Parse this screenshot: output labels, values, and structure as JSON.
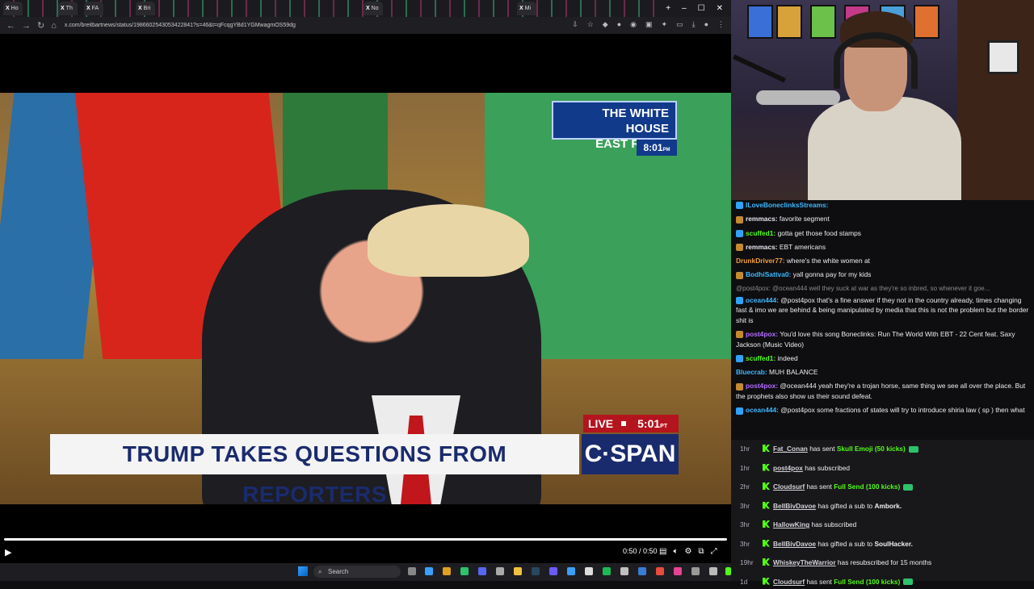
{
  "browser": {
    "tabs": [
      "Ho",
      "Th",
      "FA",
      "Bri",
      "No",
      "Mi"
    ],
    "url": "x.com/breitbartnews/status/1986602543053422841?s=46&t=qFcqgYBd1YGMwagmOS59dg",
    "window_controls": {
      "minimize": "–",
      "maximize": "☐",
      "close": "✕"
    }
  },
  "video": {
    "location_line1": "THE WHITE HOUSE",
    "location_line2": "EAST ROOM",
    "clock": "8:01",
    "clock_suffix": "PM",
    "live_label": "LIVE",
    "live_time": "5:01",
    "live_suffix": "PT",
    "headline": "TRUMP TAKES QUESTIONS FROM REPORTERS",
    "network": "C·SPAN"
  },
  "player": {
    "time": "0:50 / 0:50",
    "progress": 1.0
  },
  "taskbar": {
    "search_placeholder": "Search"
  },
  "chat": {
    "messages": [
      {
        "user": "ILoveBoneclinksStreams:",
        "text": "",
        "color": "#3fb7ff",
        "badge": "#2fa3ff"
      },
      {
        "user": "remmacs:",
        "text": "favorite segment",
        "color": "#e6e6ee",
        "badge": "#c48a2e"
      },
      {
        "user": "scuffed1:",
        "text": "gotta get those food stamps",
        "color": "#53fc18",
        "badge": "#2fa3ff"
      },
      {
        "user": "remmacs:",
        "text": "EBT americans",
        "color": "#e6e6ee",
        "badge": "#c48a2e"
      },
      {
        "user": "DrunkDriver77:",
        "text": "where's the white women at",
        "color": "#f0a03a",
        "badge": ""
      },
      {
        "user": "BodhiSattva0:",
        "text": "yall gonna pay for my kids",
        "color": "#3fb7ff",
        "badge": "#c48a2e"
      }
    ],
    "reply_preview": "@post4pox: @ocean444 well they suck at war as they're so inbred, so whenever it goe...",
    "messages2": [
      {
        "user": "ocean444:",
        "text": "@post4pox that's a fine answer if they not in the country already, times changing fast & imo we are behind & being manipulated by media that this is not the problem but the border shit is",
        "color": "#3fb7ff",
        "badge": "#2fa3ff"
      },
      {
        "user": "post4pox:",
        "text": "You'd love this song Boneclinks: Run The World With EBT - 22 Cent feat. Saxy Jackson (Music Video)",
        "color": "#b36bff",
        "badge": "#c48a2e"
      },
      {
        "user": "scuffed1:",
        "text": "indeed",
        "color": "#53fc18",
        "badge": "#2fa3ff"
      },
      {
        "user": "Bluecrab:",
        "text": "MUH BALANCE",
        "color": "#3fb7ff",
        "badge": ""
      },
      {
        "user": "post4pox:",
        "text": "@ocean444 yeah they're a trojan horse, same thing we see all over the place. But the prophets also show us their sound defeat.",
        "color": "#b36bff",
        "badge": "#c48a2e"
      },
      {
        "user": "ocean444:",
        "text": "@post4pox some fractions of states will try to introduce shiria law ( sp ) then what",
        "color": "#3fb7ff",
        "badge": "#2fa3ff"
      }
    ]
  },
  "events": [
    {
      "age": "1hr",
      "name": "Fat_Conan",
      "action": "has sent",
      "highlight": "Skull Emoji (50 kicks)",
      "tail": "",
      "coin": true
    },
    {
      "age": "1hr",
      "name": "post4pox",
      "action": "has subscribed",
      "highlight": "",
      "tail": "",
      "coin": false
    },
    {
      "age": "2hr",
      "name": "Cloudsurf",
      "action": "has sent",
      "highlight": "Full Send (100 kicks)",
      "tail": "",
      "coin": true
    },
    {
      "age": "3hr",
      "name": "BellBivDavoe",
      "action": "has gifted a sub to",
      "highlight": "",
      "tail": "Ambork.",
      "coin": false
    },
    {
      "age": "3hr",
      "name": "HallowKing",
      "action": "has subscribed",
      "highlight": "",
      "tail": "",
      "coin": false
    },
    {
      "age": "3hr",
      "name": "BellBivDavoe",
      "action": "has gifted a sub to",
      "highlight": "",
      "tail": "SoulHacker.",
      "coin": false
    },
    {
      "age": "19hr",
      "name": "WhiskeyTheWarrior",
      "action": "has resubscribed for 15 months",
      "highlight": "",
      "tail": "",
      "coin": false
    },
    {
      "age": "1d",
      "name": "Cloudsurf",
      "action": "has sent",
      "highlight": "Full Send (100 kicks)",
      "tail": "",
      "coin": true
    }
  ]
}
